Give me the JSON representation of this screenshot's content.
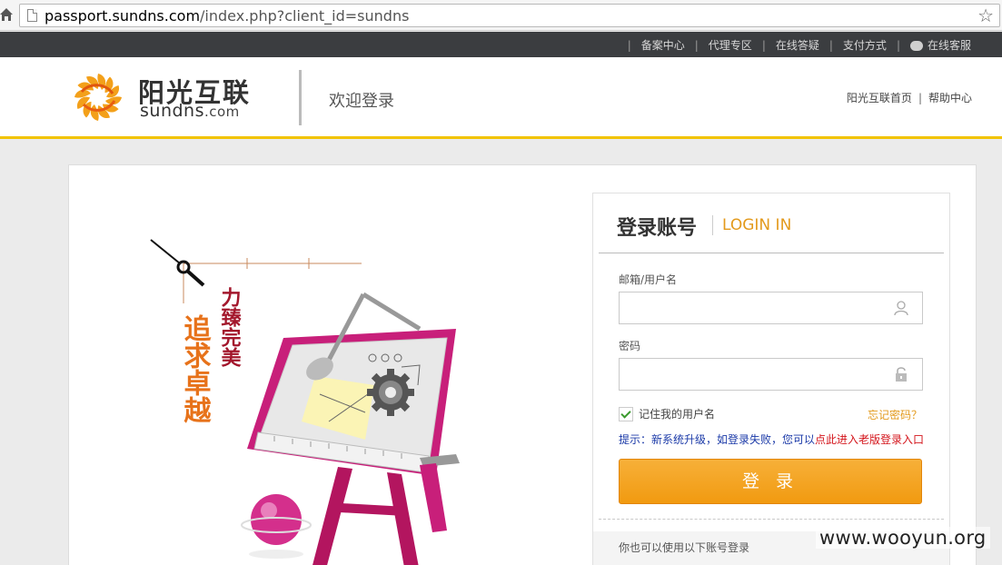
{
  "browser": {
    "url_host": "passport.sundns.com",
    "url_path": "/index.php?client_id=sundns"
  },
  "topnav": {
    "items": [
      "备案中心",
      "代理专区",
      "在线答疑",
      "支付方式",
      "在线客服"
    ],
    "separator": "|"
  },
  "header": {
    "brand_cn": "阳光互联",
    "brand_en": "sundns",
    "brand_en_suffix": ".com",
    "welcome": "欢迎登录",
    "links": [
      "阳光互联首页",
      "帮助中心"
    ],
    "link_separator": "|"
  },
  "illustration": {
    "slogan_1": "力臻完美",
    "slogan_2": "追求卓越",
    "colors": {
      "magenta": "#c81f7a",
      "orange": "#e7721a",
      "crimson": "#a3172c"
    }
  },
  "login": {
    "title": "登录账号",
    "title_en": "LOGIN IN",
    "username_label": "邮箱/用户名",
    "username_value": "",
    "password_label": "密码",
    "password_value": "",
    "remember_label": "记住我的用户名",
    "remember_checked": true,
    "forgot_label": "忘记密码？",
    "hint_prefix": "提示：新系统升级，如登录失败，您可以",
    "hint_link": "点此进入老版登录入口",
    "submit_label": "登 录",
    "alt_login_label": "你也可以使用以下账号登录"
  },
  "watermark": "www.wooyun.org",
  "colors": {
    "accent_orange": "#f19a10",
    "header_border_yellow": "#f2c300",
    "topnav_bg": "#3b3d40",
    "hint_blue": "#1b3aa8",
    "hint_red": "#d4141b"
  }
}
